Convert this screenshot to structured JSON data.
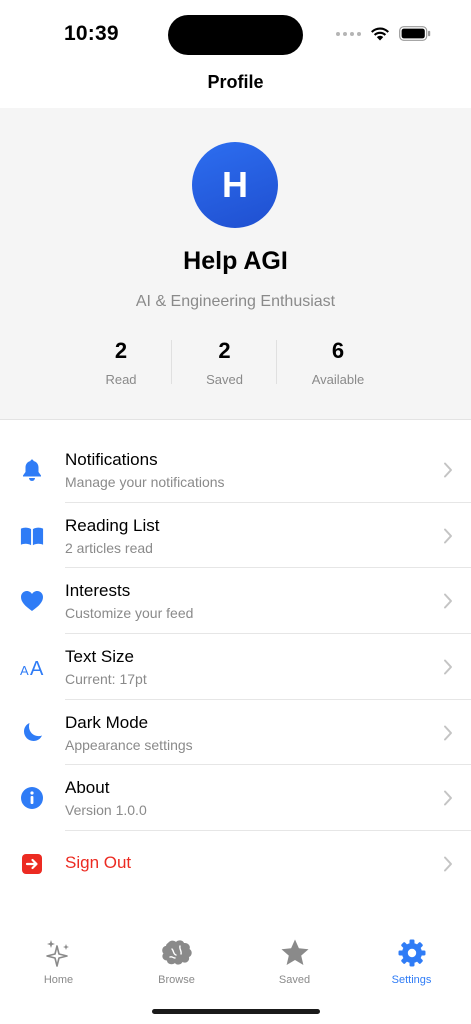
{
  "status_bar": {
    "time": "10:39",
    "icons": [
      "signal-dots-icon",
      "wifi-icon",
      "battery-icon"
    ]
  },
  "nav": {
    "title": "Profile"
  },
  "profile": {
    "avatar_letter": "H",
    "name": "Help AGI",
    "subtitle": "AI & Engineering Enthusiast",
    "avatar_color": "#2a62e6",
    "stats": [
      {
        "value": "2",
        "label": "Read"
      },
      {
        "value": "2",
        "label": "Saved"
      },
      {
        "value": "6",
        "label": "Available"
      }
    ]
  },
  "settings": {
    "accent_color": "#2f7cf6",
    "danger_color": "#ec2b22",
    "items": [
      {
        "icon": "bell-icon",
        "title": "Notifications",
        "subtitle": "Manage your notifications"
      },
      {
        "icon": "book-icon",
        "title": "Reading List",
        "subtitle": "2 articles read"
      },
      {
        "icon": "heart-icon",
        "title": "Interests",
        "subtitle": "Customize your feed"
      },
      {
        "icon": "text-size-icon",
        "title": "Text Size",
        "subtitle": "Current: 17pt"
      },
      {
        "icon": "moon-icon",
        "title": "Dark Mode",
        "subtitle": "Appearance settings"
      },
      {
        "icon": "info-icon",
        "title": "About",
        "subtitle": "Version 1.0.0"
      },
      {
        "icon": "sign-out-icon",
        "title": "Sign Out",
        "subtitle": ""
      }
    ]
  },
  "tab_bar": {
    "active": "Settings",
    "tabs": [
      {
        "label": "Home",
        "icon": "sparkles-icon"
      },
      {
        "label": "Browse",
        "icon": "brain-icon"
      },
      {
        "label": "Saved",
        "icon": "star-icon"
      },
      {
        "label": "Settings",
        "icon": "gear-icon"
      }
    ]
  }
}
